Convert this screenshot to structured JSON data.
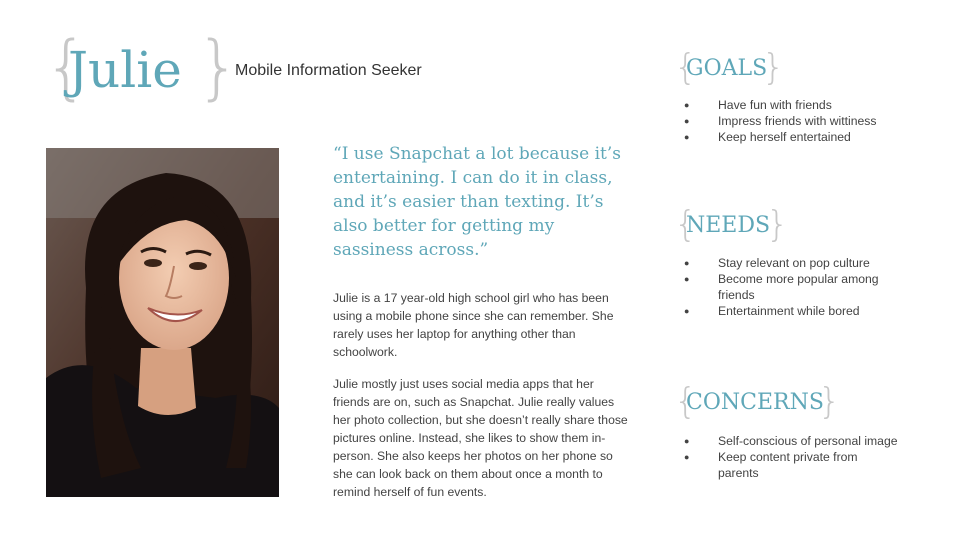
{
  "persona": {
    "name": "Julie",
    "subtitle": "Mobile Information Seeker"
  },
  "quote": "“I use Snapchat a lot because it’s entertaining. I can do it in class, and it’s easier than texting. It’s also better for getting my sassiness across.”",
  "bio": [
    "Julie is a 17 year-old high school girl who has been using a mobile phone since she can remember. She rarely uses her laptop for anything other than schoolwork.",
    "Julie mostly just uses social media apps that her friends are on, such as Snapchat. Julie really values her photo collection, but she doesn’t really share those pictures online. Instead, she likes to show them in-person. She also keeps her photos on her phone so she can look back on them about once a month to remind herself of fun events."
  ],
  "goals": {
    "heading": "GOALS",
    "items": [
      "Have fun with friends",
      "Impress friends with wittiness",
      "Keep herself entertained"
    ]
  },
  "needs": {
    "heading": "NEEDS",
    "items": [
      "Stay relevant on pop culture",
      "Become more popular among friends",
      "Entertainment while bored"
    ]
  },
  "concerns": {
    "heading": "CONCERNS",
    "items": [
      "Self-conscious of personal image",
      "Keep content private from parents"
    ]
  },
  "colors": {
    "accent": "#5fa7b8",
    "brace": "#c8c8c8",
    "text": "#434343"
  }
}
